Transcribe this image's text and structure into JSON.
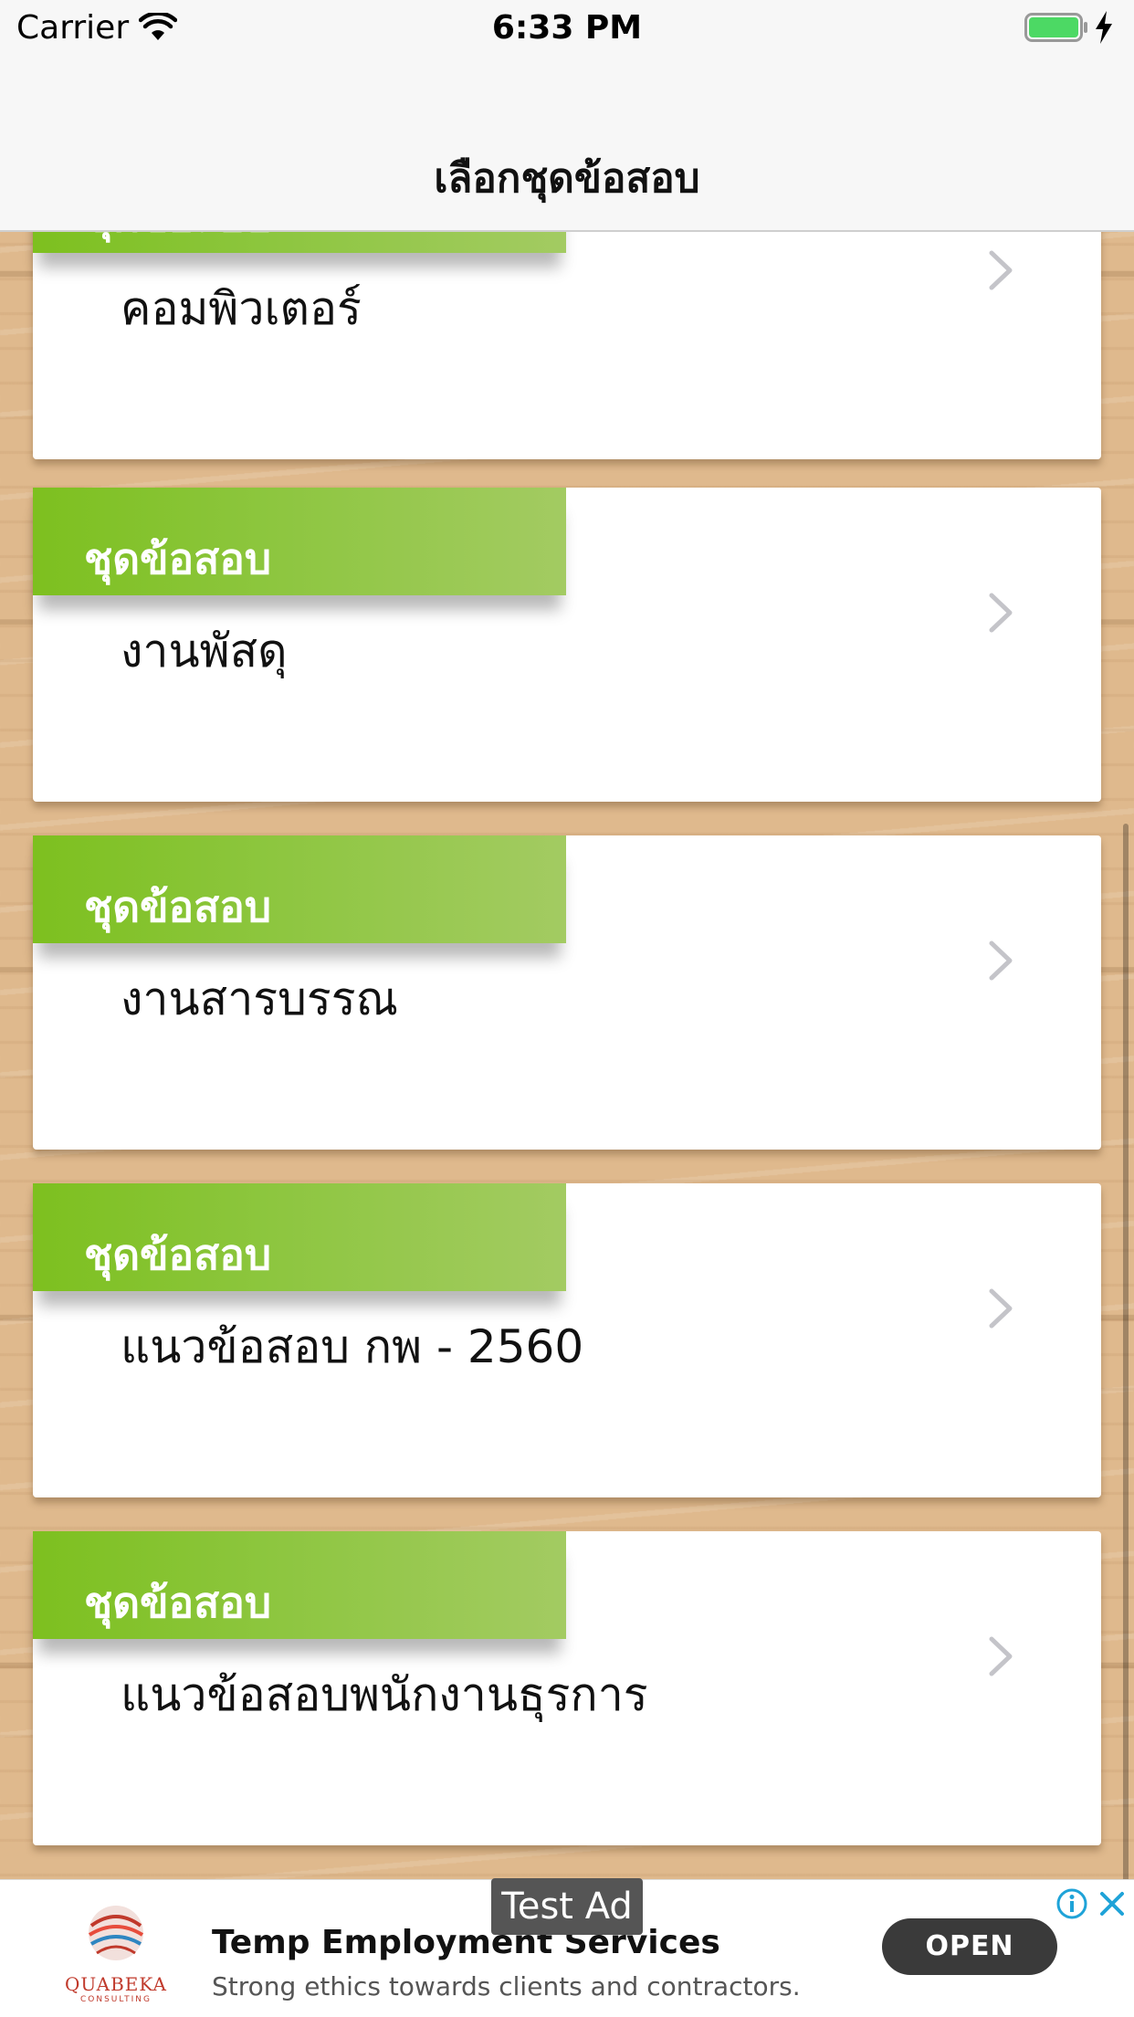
{
  "status_bar": {
    "carrier": "Carrier",
    "time": "6:33 PM"
  },
  "nav": {
    "title": "เลือกชุดข้อสอบ"
  },
  "cards": [
    {
      "tab_label": "ชุดข้อสอบ",
      "title": "คอมพิวเตอร์"
    },
    {
      "tab_label": "ชุดข้อสอบ",
      "title": "งานพัสดุ"
    },
    {
      "tab_label": "ชุดข้อสอบ",
      "title": "งานสารบรรณ"
    },
    {
      "tab_label": "ชุดข้อสอบ",
      "title": "แนวข้อสอบ กพ - 2560"
    },
    {
      "tab_label": "ชุดข้อสอบ",
      "title": "แนวข้อสอบพนักงานธุรการ"
    }
  ],
  "ad": {
    "test_label": "Test Ad",
    "title": "Temp Employment Services",
    "description": "Strong ethics towards clients and contractors.",
    "button_label": "OPEN",
    "logo_text": "QUABEKA",
    "logo_subtext": "CONSULTING"
  },
  "colors": {
    "tab_green": "#8dc63f",
    "nav_background": "#f7f7f7",
    "wood": "#dfb98d",
    "battery_green": "#4cd964"
  },
  "icons": {
    "wifi": "wifi-icon",
    "battery": "battery-icon",
    "charging": "bolt-icon",
    "row_arrow": "chevron-right-icon",
    "ad_info": "info-icon",
    "ad_close": "close-icon"
  }
}
